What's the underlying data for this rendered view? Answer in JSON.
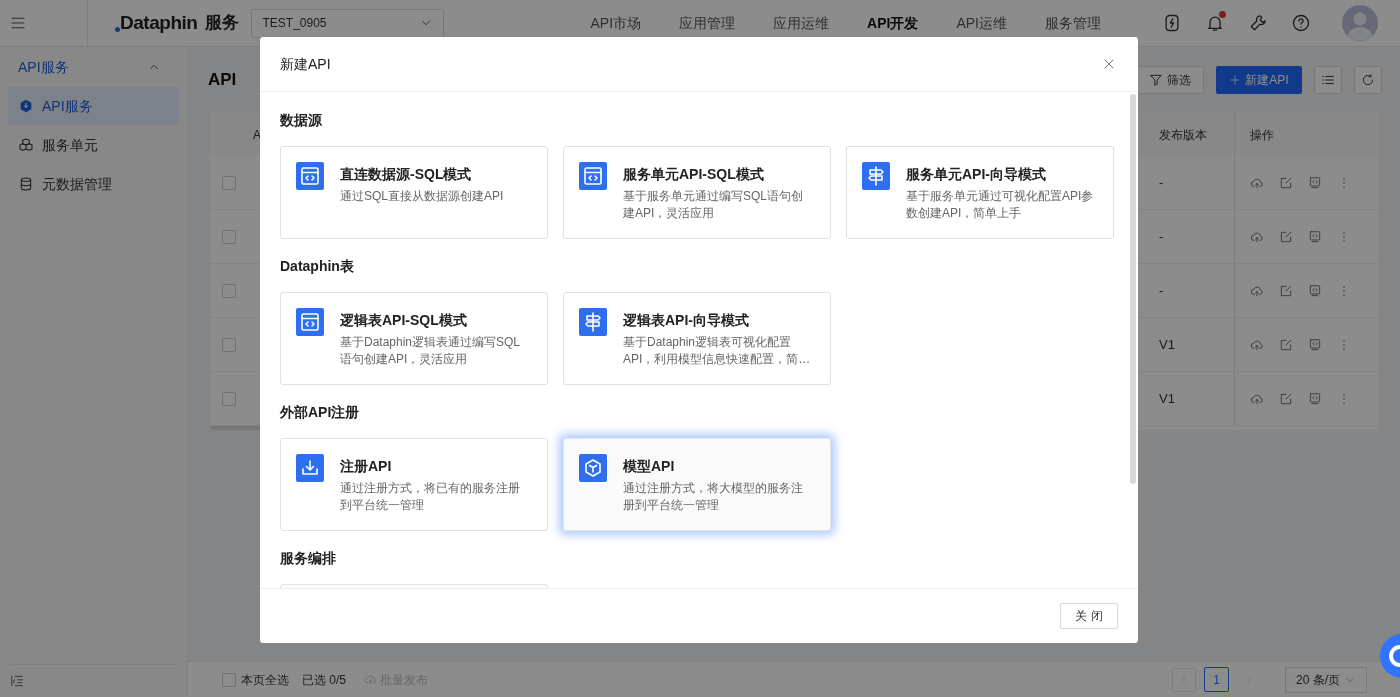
{
  "header": {
    "logo": "Dataphin",
    "product": "服务",
    "project": "TEST_0905",
    "nav": [
      {
        "label": "API市场",
        "selected": false
      },
      {
        "label": "应用管理",
        "selected": false
      },
      {
        "label": "应用运维",
        "selected": false
      },
      {
        "label": "API开发",
        "selected": true
      },
      {
        "label": "API运维",
        "selected": false
      },
      {
        "label": "服务管理",
        "selected": false
      }
    ],
    "notification_unread": true
  },
  "sidebar": {
    "group": {
      "label": "API服务",
      "expanded": true
    },
    "items": [
      {
        "label": "API服务",
        "kind": "api",
        "selected": true
      },
      {
        "label": "服务单元",
        "kind": "unit",
        "selected": false
      },
      {
        "label": "元数据管理",
        "kind": "metadata",
        "selected": false
      }
    ]
  },
  "page": {
    "title": "API",
    "filter_button": "筛选",
    "create_button": "新建API"
  },
  "table": {
    "columns": [
      "A",
      "发布版本",
      "操作"
    ],
    "rows": [
      {
        "checked": false,
        "version": "-"
      },
      {
        "checked": false,
        "version": "-"
      },
      {
        "checked": false,
        "version": "-"
      },
      {
        "checked": false,
        "version": "V1"
      },
      {
        "checked": false,
        "version": "V1"
      }
    ]
  },
  "footer": {
    "select_all": {
      "label": "本页全选",
      "checked": false
    },
    "selected_count": "已选 0/5",
    "batch_publish": {
      "label": "批量发布",
      "disabled": true
    },
    "pages": [
      {
        "label": "1",
        "selected": true
      }
    ],
    "page_size": "20 条/页"
  },
  "modal": {
    "title": "新建API",
    "close_button": "关 闭",
    "sections": [
      {
        "title": "数据源",
        "options": [
          {
            "kind": "sql",
            "title": "直连数据源-SQL模式",
            "description": "通过SQL直接从数据源创建API",
            "selected": false
          },
          {
            "kind": "sql",
            "title": "服务单元API-SQL模式",
            "description": "基于服务单元通过编写SQL语句创建API，灵活应用",
            "selected": false
          },
          {
            "kind": "wizard",
            "title": "服务单元API-向导模式",
            "description": "基于服务单元通过可视化配置API参数创建API，简单上手",
            "selected": false
          }
        ]
      },
      {
        "title": "Dataphin表",
        "options": [
          {
            "kind": "sql",
            "title": "逻辑表API-SQL模式",
            "description": "基于Dataphin逻辑表通过编写SQL语句创建API，灵活应用",
            "selected": false
          },
          {
            "kind": "wizard",
            "title": "逻辑表API-向导模式",
            "description": "基于Dataphin逻辑表可视化配置API，利用模型信息快速配置，简…",
            "selected": false
          }
        ]
      },
      {
        "title": "外部API注册",
        "options": [
          {
            "kind": "register",
            "title": "注册API",
            "description": "通过注册方式，将已有的服务注册到平台统一管理",
            "selected": false
          },
          {
            "kind": "model",
            "title": "模型API",
            "description": "通过注册方式，将大模型的服务注册到平台统一管理",
            "selected": true
          }
        ]
      },
      {
        "title": "服务编排"
      }
    ]
  }
}
